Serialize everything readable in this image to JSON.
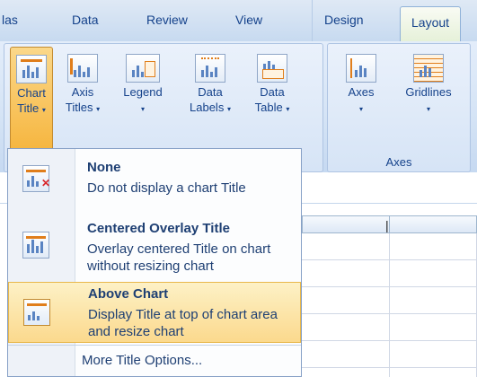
{
  "tabs": {
    "items": [
      "las",
      "Data",
      "Review",
      "View",
      "Design",
      "Layout"
    ],
    "active": "Layout"
  },
  "ribbon": {
    "buttons": [
      {
        "line1": "Chart",
        "line2": "Title"
      },
      {
        "line1": "Axis",
        "line2": "Titles"
      },
      {
        "line1": "Legend",
        "line2": ""
      },
      {
        "line1": "Data",
        "line2": "Labels"
      },
      {
        "line1": "Data",
        "line2": "Table"
      },
      {
        "line1": "Axes",
        "line2": ""
      },
      {
        "line1": "Gridlines",
        "line2": ""
      }
    ],
    "dropdown_arrow": "▾",
    "groups": {
      "axes_label": "Axes"
    }
  },
  "menu": {
    "items": [
      {
        "title": "None",
        "desc": "Do not display a chart Title",
        "icon": "chart-no-title-icon"
      },
      {
        "title": "Centered Overlay Title",
        "desc": "Overlay centered Title on chart without resizing chart",
        "icon": "chart-overlay-title-icon"
      },
      {
        "title": "Above Chart",
        "desc": "Display Title at top of chart area and resize chart",
        "icon": "chart-above-title-icon",
        "selected": true
      }
    ],
    "more": "More Title Options..."
  },
  "sheet": {
    "cell_text": "|"
  },
  "colors": {
    "accent_orange": "#f6b53e",
    "ribbon_text": "#15428b"
  }
}
